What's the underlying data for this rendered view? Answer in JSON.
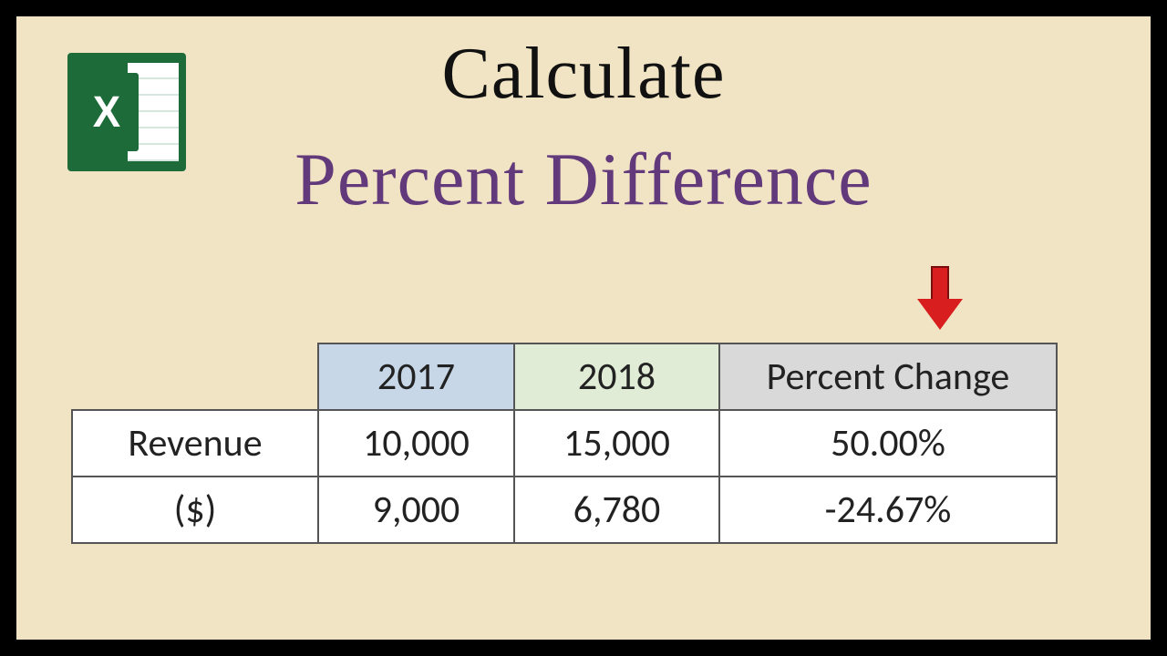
{
  "icon": {
    "letter": "X"
  },
  "title": {
    "line1": "Calculate",
    "line2": "Percent Difference"
  },
  "table": {
    "headers": {
      "col1": "2017",
      "col2": "2018",
      "col3": "Percent Change"
    },
    "rowLabel": {
      "line1": "Revenue",
      "line2": "($)"
    },
    "rows": [
      {
        "v2017": "10,000",
        "v2018": "15,000",
        "pct": "50.00%"
      },
      {
        "v2017": "9,000",
        "v2018": "6,780",
        "pct": "-24.67%"
      }
    ]
  },
  "chart_data": {
    "type": "table",
    "title": "Percent Difference",
    "row_label": "Revenue ($)",
    "columns": [
      "2017",
      "2018",
      "Percent Change"
    ],
    "rows": [
      {
        "2017": 10000,
        "2018": 15000,
        "percent_change": 50.0
      },
      {
        "2017": 9000,
        "2018": 6780,
        "percent_change": -24.67
      }
    ]
  }
}
